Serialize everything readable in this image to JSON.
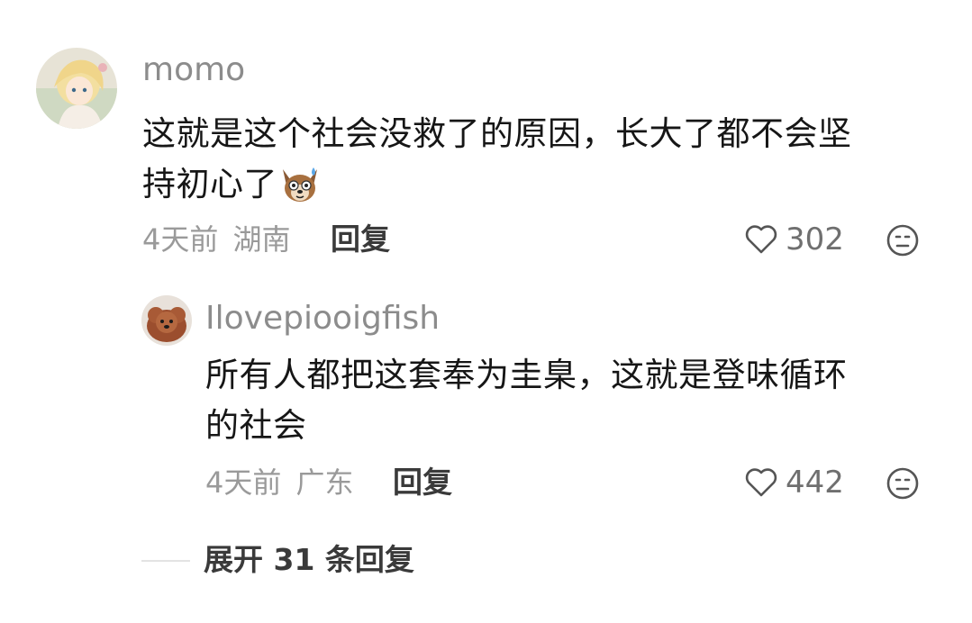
{
  "comment": {
    "username": "momo",
    "text_line1": "这就是这个社会没救了的原因，长大了都不会坚",
    "text_line2": "持初心了",
    "emoji": "dog-sweat-emoji",
    "time": "4天前",
    "location": "湖南",
    "reply_label": "回复",
    "likes": "302"
  },
  "reply": {
    "username": "Ilovepiooigfish",
    "text_line1": "所有人都把这套奉为圭臬，这就是登味循环",
    "text_line2": "的社会",
    "time": "4天前",
    "location": "广东",
    "reply_label": "回复",
    "likes": "442"
  },
  "expand_label": "展开 31 条回复",
  "icons": {
    "like": "heart-outline-icon",
    "dislike": "unhappy-face-icon"
  },
  "colors": {
    "username": "#8c8c8c",
    "meta": "#9a9a9a",
    "text": "#161616"
  }
}
